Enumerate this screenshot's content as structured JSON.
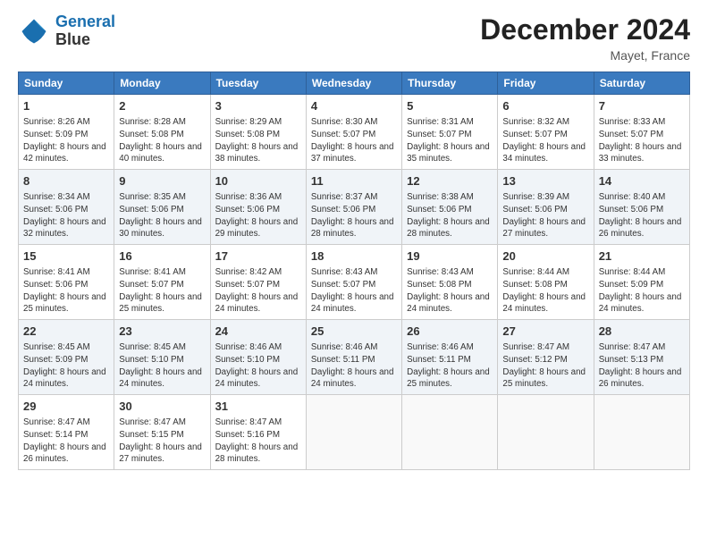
{
  "header": {
    "logo_line1": "General",
    "logo_line2": "Blue",
    "month": "December 2024",
    "location": "Mayet, France"
  },
  "weekdays": [
    "Sunday",
    "Monday",
    "Tuesday",
    "Wednesday",
    "Thursday",
    "Friday",
    "Saturday"
  ],
  "weeks": [
    [
      {
        "day": "1",
        "sunrise": "8:26 AM",
        "sunset": "5:09 PM",
        "daylight": "8 hours and 42 minutes."
      },
      {
        "day": "2",
        "sunrise": "8:28 AM",
        "sunset": "5:08 PM",
        "daylight": "8 hours and 40 minutes."
      },
      {
        "day": "3",
        "sunrise": "8:29 AM",
        "sunset": "5:08 PM",
        "daylight": "8 hours and 38 minutes."
      },
      {
        "day": "4",
        "sunrise": "8:30 AM",
        "sunset": "5:07 PM",
        "daylight": "8 hours and 37 minutes."
      },
      {
        "day": "5",
        "sunrise": "8:31 AM",
        "sunset": "5:07 PM",
        "daylight": "8 hours and 35 minutes."
      },
      {
        "day": "6",
        "sunrise": "8:32 AM",
        "sunset": "5:07 PM",
        "daylight": "8 hours and 34 minutes."
      },
      {
        "day": "7",
        "sunrise": "8:33 AM",
        "sunset": "5:07 PM",
        "daylight": "8 hours and 33 minutes."
      }
    ],
    [
      {
        "day": "8",
        "sunrise": "8:34 AM",
        "sunset": "5:06 PM",
        "daylight": "8 hours and 32 minutes."
      },
      {
        "day": "9",
        "sunrise": "8:35 AM",
        "sunset": "5:06 PM",
        "daylight": "8 hours and 30 minutes."
      },
      {
        "day": "10",
        "sunrise": "8:36 AM",
        "sunset": "5:06 PM",
        "daylight": "8 hours and 29 minutes."
      },
      {
        "day": "11",
        "sunrise": "8:37 AM",
        "sunset": "5:06 PM",
        "daylight": "8 hours and 28 minutes."
      },
      {
        "day": "12",
        "sunrise": "8:38 AM",
        "sunset": "5:06 PM",
        "daylight": "8 hours and 28 minutes."
      },
      {
        "day": "13",
        "sunrise": "8:39 AM",
        "sunset": "5:06 PM",
        "daylight": "8 hours and 27 minutes."
      },
      {
        "day": "14",
        "sunrise": "8:40 AM",
        "sunset": "5:06 PM",
        "daylight": "8 hours and 26 minutes."
      }
    ],
    [
      {
        "day": "15",
        "sunrise": "8:41 AM",
        "sunset": "5:06 PM",
        "daylight": "8 hours and 25 minutes."
      },
      {
        "day": "16",
        "sunrise": "8:41 AM",
        "sunset": "5:07 PM",
        "daylight": "8 hours and 25 minutes."
      },
      {
        "day": "17",
        "sunrise": "8:42 AM",
        "sunset": "5:07 PM",
        "daylight": "8 hours and 24 minutes."
      },
      {
        "day": "18",
        "sunrise": "8:43 AM",
        "sunset": "5:07 PM",
        "daylight": "8 hours and 24 minutes."
      },
      {
        "day": "19",
        "sunrise": "8:43 AM",
        "sunset": "5:08 PM",
        "daylight": "8 hours and 24 minutes."
      },
      {
        "day": "20",
        "sunrise": "8:44 AM",
        "sunset": "5:08 PM",
        "daylight": "8 hours and 24 minutes."
      },
      {
        "day": "21",
        "sunrise": "8:44 AM",
        "sunset": "5:09 PM",
        "daylight": "8 hours and 24 minutes."
      }
    ],
    [
      {
        "day": "22",
        "sunrise": "8:45 AM",
        "sunset": "5:09 PM",
        "daylight": "8 hours and 24 minutes."
      },
      {
        "day": "23",
        "sunrise": "8:45 AM",
        "sunset": "5:10 PM",
        "daylight": "8 hours and 24 minutes."
      },
      {
        "day": "24",
        "sunrise": "8:46 AM",
        "sunset": "5:10 PM",
        "daylight": "8 hours and 24 minutes."
      },
      {
        "day": "25",
        "sunrise": "8:46 AM",
        "sunset": "5:11 PM",
        "daylight": "8 hours and 24 minutes."
      },
      {
        "day": "26",
        "sunrise": "8:46 AM",
        "sunset": "5:11 PM",
        "daylight": "8 hours and 25 minutes."
      },
      {
        "day": "27",
        "sunrise": "8:47 AM",
        "sunset": "5:12 PM",
        "daylight": "8 hours and 25 minutes."
      },
      {
        "day": "28",
        "sunrise": "8:47 AM",
        "sunset": "5:13 PM",
        "daylight": "8 hours and 26 minutes."
      }
    ],
    [
      {
        "day": "29",
        "sunrise": "8:47 AM",
        "sunset": "5:14 PM",
        "daylight": "8 hours and 26 minutes."
      },
      {
        "day": "30",
        "sunrise": "8:47 AM",
        "sunset": "5:15 PM",
        "daylight": "8 hours and 27 minutes."
      },
      {
        "day": "31",
        "sunrise": "8:47 AM",
        "sunset": "5:16 PM",
        "daylight": "8 hours and 28 minutes."
      },
      null,
      null,
      null,
      null
    ]
  ],
  "labels": {
    "sunrise": "Sunrise:",
    "sunset": "Sunset:",
    "daylight": "Daylight:"
  }
}
